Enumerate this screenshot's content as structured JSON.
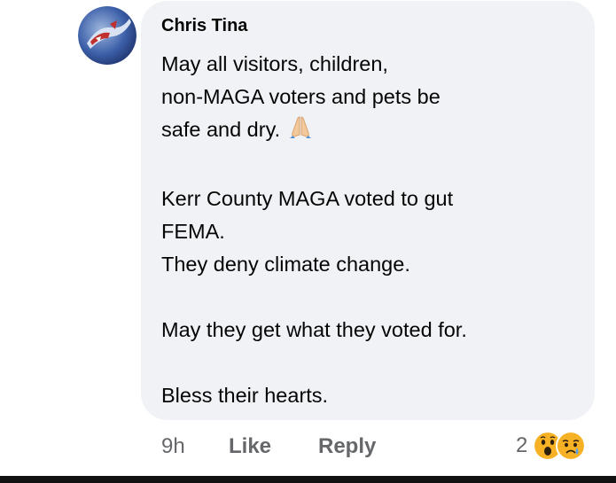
{
  "comment": {
    "author": "Chris Tina",
    "paragraphs": [
      [
        "May all visitors, children,",
        "non-MAGA voters and pets be",
        "safe and dry."
      ],
      [
        "Kerr County MAGA voted to gut",
        "FEMA.",
        "They deny climate change."
      ],
      [
        "May they get what they voted for."
      ],
      [
        "Bless their hearts."
      ]
    ],
    "inline_emoji": "folded-hands-icon",
    "timestamp": "9h",
    "like_label": "Like",
    "reply_label": "Reply",
    "reaction_count": "2",
    "reactions": [
      "wow-reaction-icon",
      "sad-reaction-icon"
    ]
  },
  "colors": {
    "bubble": "#f0f2f5",
    "meta_text": "#65676b",
    "reaction_yellow": "#f7b125"
  }
}
